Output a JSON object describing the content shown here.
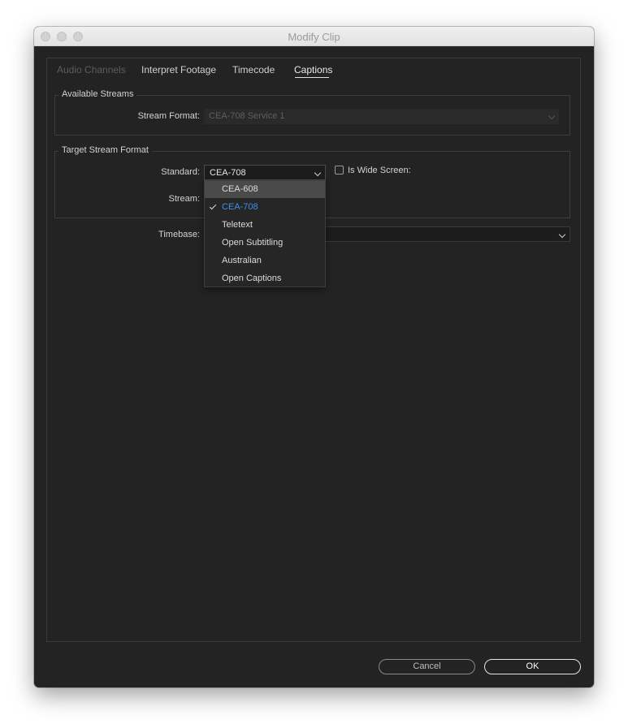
{
  "window": {
    "title": "Modify Clip"
  },
  "tabs": [
    {
      "label": "Audio Channels",
      "state": "disabled"
    },
    {
      "label": "Interpret Footage",
      "state": "normal"
    },
    {
      "label": "Timecode",
      "state": "normal"
    },
    {
      "label": "Captions",
      "state": "active"
    }
  ],
  "available_streams": {
    "legend": "Available Streams",
    "stream_format_label": "Stream Format:",
    "stream_format_value": "CEA-708 Service 1"
  },
  "target_stream": {
    "legend": "Target Stream Format",
    "standard_label": "Standard:",
    "standard_value": "CEA-708",
    "wide_screen_label": "Is Wide Screen:",
    "wide_screen_checked": false,
    "stream_label": "Stream:"
  },
  "timebase": {
    "label": "Timebase:"
  },
  "standard_options": [
    {
      "label": "CEA-608",
      "hovered": true,
      "selected": false
    },
    {
      "label": "CEA-708",
      "hovered": false,
      "selected": true
    },
    {
      "label": "Teletext",
      "hovered": false,
      "selected": false
    },
    {
      "label": "Open Subtitling",
      "hovered": false,
      "selected": false
    },
    {
      "label": "Australian",
      "hovered": false,
      "selected": false
    },
    {
      "label": "Open Captions",
      "hovered": false,
      "selected": false
    }
  ],
  "buttons": {
    "cancel": "Cancel",
    "ok": "OK"
  },
  "colors": {
    "background": "#232323",
    "selected_item": "#3f8ee8",
    "hover_item": "#4a4a4a"
  }
}
